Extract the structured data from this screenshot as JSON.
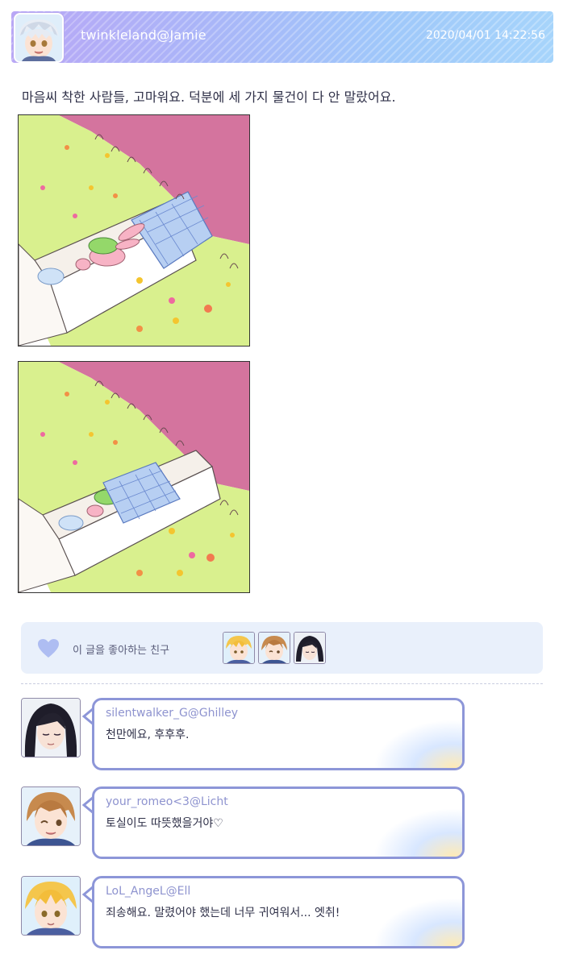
{
  "post": {
    "username": "twinkleland@Jamie",
    "timestamp": "2020/04/01 14:22:56",
    "text": "마음씨 착한 사람들, 고마워요. 덕분에 세 가지 물건이 다 안 말랐어요."
  },
  "likes": {
    "label": "이 글을 좋아하는 친구"
  },
  "comments": [
    {
      "username": "silentwalker_G@Ghilley",
      "text": "천만에요, 후후후."
    },
    {
      "username": "your_romeo<3@Licht",
      "text": "토실이도 따뜻했을거야♡"
    },
    {
      "username": "LoL_AngeL@Ell",
      "text": "죄송해요. 말렸어야 했는데 너무 귀여워서... 엣취!"
    }
  ],
  "colors": {
    "header_gradient_start": "#b9a7f6",
    "header_gradient_end": "#a6d4fb",
    "bubble_border": "#8d96d8",
    "comment_name": "#8e93cf",
    "likes_bg": "#e9f0fb",
    "heart": "#aebdf2"
  }
}
